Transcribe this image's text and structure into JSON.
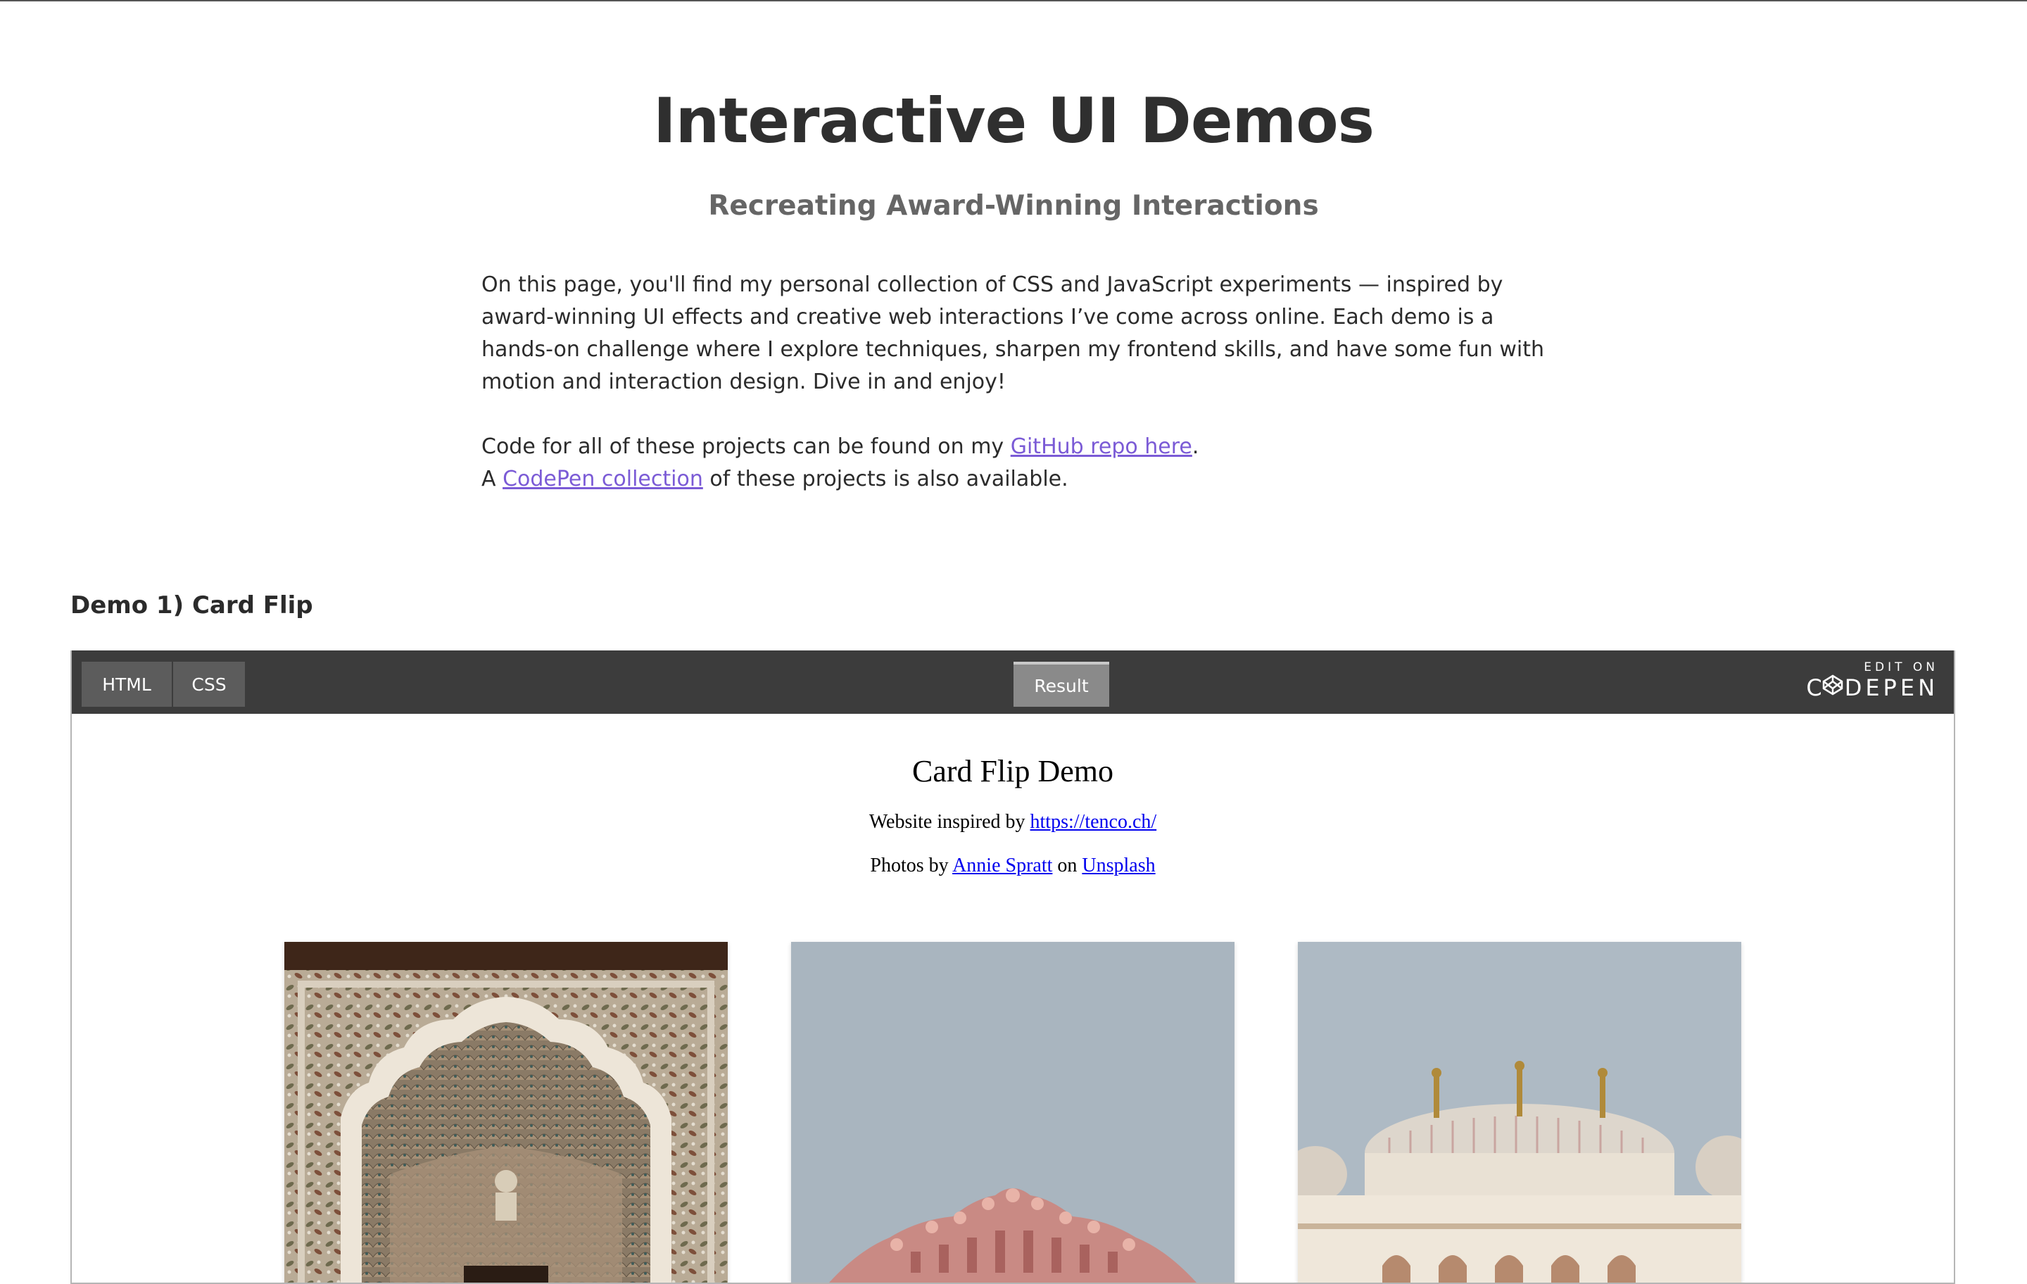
{
  "header": {
    "title": "Interactive UI Demos",
    "subtitle": "Recreating Award-Winning Interactions"
  },
  "intro": {
    "text": "On this page, you'll find my personal collection of CSS and JavaScript experiments — inspired by award-winning UI effects and creative web interactions I’ve come across online. Each demo is a hands-on challenge where I explore techniques, sharpen my frontend skills, and have some fun with motion and interaction design. Dive in and enjoy!"
  },
  "links": {
    "code_prefix": "Code for all of these projects can be found on my ",
    "github_label": "GitHub repo here",
    "code_suffix": ".",
    "codepen_prefix": "A ",
    "codepen_label": "CodePen collection",
    "codepen_suffix": " of these projects is also available."
  },
  "sections": [
    {
      "heading": "Demo 1) Card Flip",
      "embed": {
        "tabs": [
          "HTML",
          "CSS"
        ],
        "result_tab": "Result",
        "edit_on": "EDIT ON",
        "codepen_text": "DEPEN",
        "result": {
          "title": "Card Flip Demo",
          "inspired_prefix": "Website inspired by ",
          "inspired_link": "https://tenco.ch/",
          "photos_prefix": "Photos by ",
          "photographer": "Annie Spratt",
          "photos_mid": " on ",
          "photos_site": "Unsplash"
        }
      }
    }
  ],
  "colors": {
    "link": "#7b5bd6",
    "embed_bar": "#3c3c3c",
    "tab": "#5c5c5c",
    "result_tab": "#8a8a8a"
  }
}
